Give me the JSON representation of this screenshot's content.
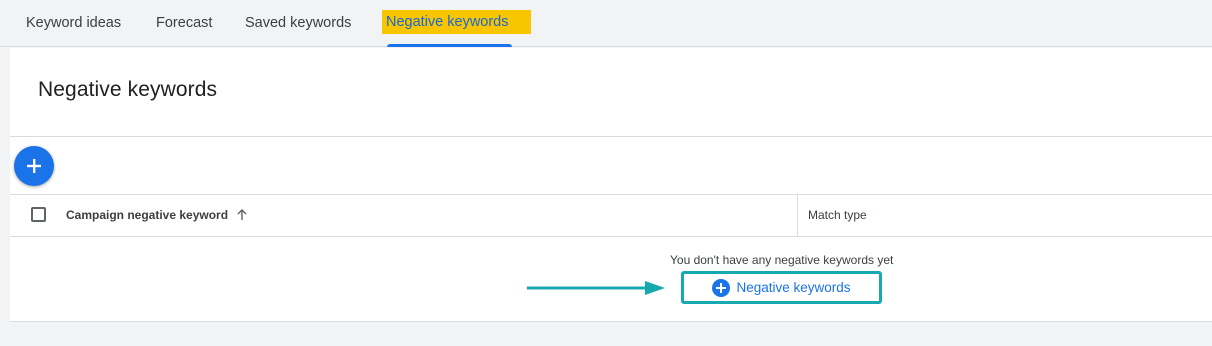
{
  "tabs": [
    {
      "label": "Keyword ideas",
      "active": false
    },
    {
      "label": "Forecast",
      "active": false
    },
    {
      "label": "Saved keywords",
      "active": false
    },
    {
      "label": "Negative keywords",
      "active": true
    }
  ],
  "page": {
    "title": "Negative keywords"
  },
  "fab": {
    "icon": "plus-icon"
  },
  "table": {
    "columns": [
      {
        "label": "Campaign negative keyword",
        "sort": "ascending"
      },
      {
        "label": "Match type"
      }
    ],
    "empty_message": "You don't have any negative keywords yet",
    "add_link_label": "Negative keywords"
  },
  "colors": {
    "accent": "#1a73e8",
    "highlight": "#f7c600",
    "callout": "#17a9b0"
  }
}
